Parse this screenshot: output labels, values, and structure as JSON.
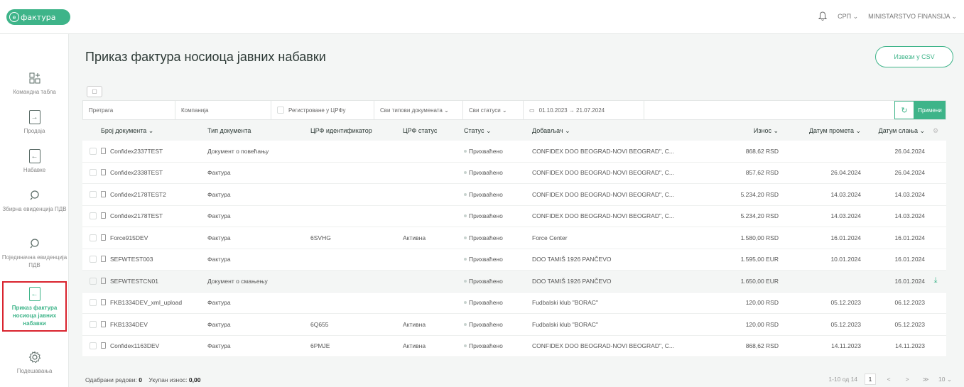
{
  "logo": {
    "circle": "е",
    "text": "фактура"
  },
  "top": {
    "lang": "СРП ⌄",
    "org": "MINISTARSTVO FINANSIJA ⌄"
  },
  "sidebar": {
    "items": [
      {
        "label": "Командна табла"
      },
      {
        "label": "Продаја"
      },
      {
        "label": "Набавке"
      },
      {
        "label": "Збирна евиденција ПДВ"
      },
      {
        "label": "Појединачна евиденција ПДВ"
      },
      {
        "label": "Приказ фактура носиоца јавних набавки"
      },
      {
        "label": "Подешавања"
      }
    ]
  },
  "page": {
    "title": "Приказ фактура носиоца јавних набавки",
    "csv_label": "Извези у CSV"
  },
  "filters": {
    "search": "Претрага",
    "company": "Компанија",
    "registered": "Регистроване у ЦРФу",
    "doc_types": "Сви типови докумената ⌄",
    "statuses": "Сви статуси ⌄",
    "date_range": "01.10.2023 → 21.07.2024",
    "apply": "Примени"
  },
  "table": {
    "headers": [
      "Број документа ⌄",
      "Тип документа",
      "ЦРФ идентификатор",
      "ЦРФ статус",
      "Статус ⌄",
      "Добављач ⌄",
      "Износ ⌄",
      "Датум промета ⌄",
      "Датум слања ⌄"
    ],
    "rows": [
      {
        "no": "Confidex2337TEST",
        "type": "Документ о повећању",
        "crf": "",
        "crf_status": "",
        "status": "Прихваћено",
        "supplier": "CONFIDEX DOO BEOGRAD-NOVI BEOGRAD\", C...",
        "amount": "868,62 RSD",
        "turnover": "",
        "sent": "26.04.2024"
      },
      {
        "no": "Confidex2338TEST",
        "type": "Фактура",
        "crf": "",
        "crf_status": "",
        "status": "Прихваћено",
        "supplier": "CONFIDEX DOO BEOGRAD-NOVI BEOGRAD\", C...",
        "amount": "857,62 RSD",
        "turnover": "26.04.2024",
        "sent": "26.04.2024"
      },
      {
        "no": "Confidex2178TEST2",
        "type": "Фактура",
        "crf": "",
        "crf_status": "",
        "status": "Прихваћено",
        "supplier": "CONFIDEX DOO BEOGRAD-NOVI BEOGRAD\", C...",
        "amount": "5.234,20 RSD",
        "turnover": "14.03.2024",
        "sent": "14.03.2024"
      },
      {
        "no": "Confidex2178TEST",
        "type": "Фактура",
        "crf": "",
        "crf_status": "",
        "status": "Прихваћено",
        "supplier": "CONFIDEX DOO BEOGRAD-NOVI BEOGRAD\", C...",
        "amount": "5.234,20 RSD",
        "turnover": "14.03.2024",
        "sent": "14.03.2024"
      },
      {
        "no": "Force915DEV",
        "type": "Фактура",
        "crf": "6SVHG",
        "crf_status": "Активна",
        "status": "Прихваћено",
        "supplier": "Force Center",
        "amount": "1.580,00 RSD",
        "turnover": "16.01.2024",
        "sent": "16.01.2024"
      },
      {
        "no": "SEFWTEST003",
        "type": "Фактура",
        "crf": "",
        "crf_status": "",
        "status": "Прихваћено",
        "supplier": "DOO TAMIŠ 1926 PANČEVO",
        "amount": "1.595,00 EUR",
        "turnover": "10.01.2024",
        "sent": "16.01.2024"
      },
      {
        "no": "SEFWTESTCN01",
        "type": "Документ о смањењу",
        "crf": "",
        "crf_status": "",
        "status": "Прихваћено",
        "supplier": "DOO TAMIŠ 1926 PANČEVO",
        "amount": "1.650,00 EUR",
        "turnover": "",
        "sent": "16.01.2024"
      },
      {
        "no": "FKB1334DEV_xml_upload",
        "type": "Фактура",
        "crf": "",
        "crf_status": "",
        "status": "Прихваћено",
        "supplier": "Fudbalski klub \"BORAC\"",
        "amount": "120,00 RSD",
        "turnover": "05.12.2023",
        "sent": "06.12.2023"
      },
      {
        "no": "FKB1334DEV",
        "type": "Фактура",
        "crf": "6Q655",
        "crf_status": "Активна",
        "status": "Прихваћено",
        "supplier": "Fudbalski klub \"BORAC\"",
        "amount": "120,00 RSD",
        "turnover": "05.12.2023",
        "sent": "05.12.2023"
      },
      {
        "no": "Confidex1163DEV",
        "type": "Фактура",
        "crf": "6PMJE",
        "crf_status": "Активна",
        "status": "Прихваћено",
        "supplier": "CONFIDEX DOO BEOGRAD-NOVI BEOGRAD\", C...",
        "amount": "868,62 RSD",
        "turnover": "14.11.2023",
        "sent": "14.11.2023"
      }
    ]
  },
  "footer": {
    "selected_label": "Одабрани редови:",
    "selected_value": "0",
    "total_label": "Укупан износ:",
    "total_value": "0,00"
  },
  "pager": {
    "range": "1-10 од 14",
    "page": "1",
    "prev": "<",
    "next": ">",
    "last": "≫",
    "size": "10 ⌄"
  }
}
